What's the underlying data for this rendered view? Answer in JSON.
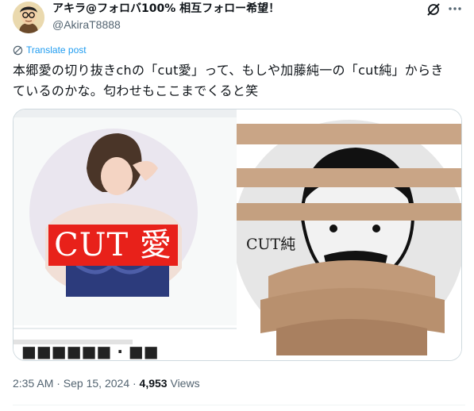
{
  "tweet": {
    "display_name": "アキラ@フォロバ100% 相互フォロー希望！",
    "handle": "@AkiraT8888",
    "translate_label": "Translate post",
    "text_line1": "本郷愛の切り抜きchの「cut愛」って、もしや加藤純一の「cut純」からき",
    "text_line2": "ているのかな。匂わせもここまでくると笑",
    "timestamp": "2:35 AM · Sep 15, 2024 · ",
    "views_count": "4,953",
    "views_label": " Views"
  },
  "media": {
    "left_image_label": "CUT 愛",
    "right_image_label": "CUT純"
  },
  "colors": {
    "accent": "#1d9bf0",
    "secondary_text": "#536471",
    "label_red": "#e8211a"
  },
  "icons": [
    "grok-icon",
    "more-icon",
    "translate-icon"
  ]
}
